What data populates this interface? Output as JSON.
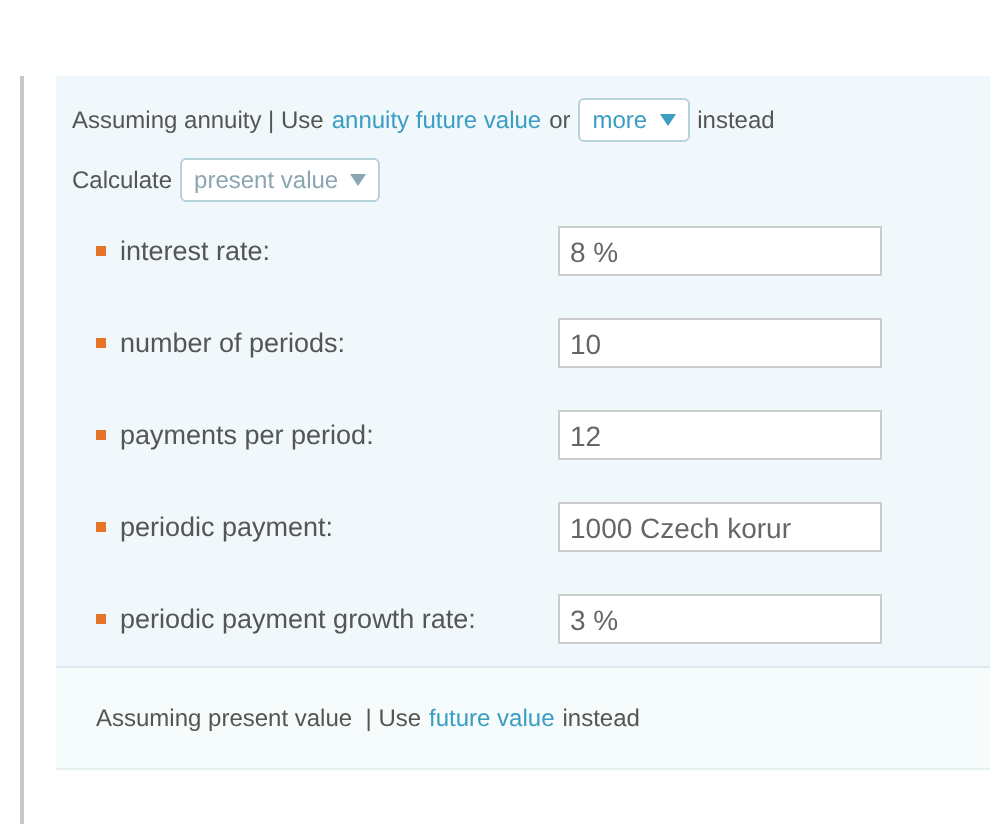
{
  "assumption": {
    "prefix": "Assuming annuity | Use",
    "link": "annuity future value",
    "middle": "or",
    "dropdown": "more",
    "suffix": "instead"
  },
  "calculate": {
    "label": "Calculate",
    "dropdown": "present value"
  },
  "inputs": [
    {
      "label": "interest rate:",
      "value": "8 %"
    },
    {
      "label": "number of periods:",
      "value": "10"
    },
    {
      "label": "payments per period:",
      "value": "12"
    },
    {
      "label": "periodic payment:",
      "value": "1000 Czech korur"
    },
    {
      "label": "periodic payment growth rate:",
      "value": "3 %"
    }
  ],
  "footer": {
    "prefix": "Assuming present value  | Use",
    "link": "future value",
    "suffix": "instead"
  }
}
